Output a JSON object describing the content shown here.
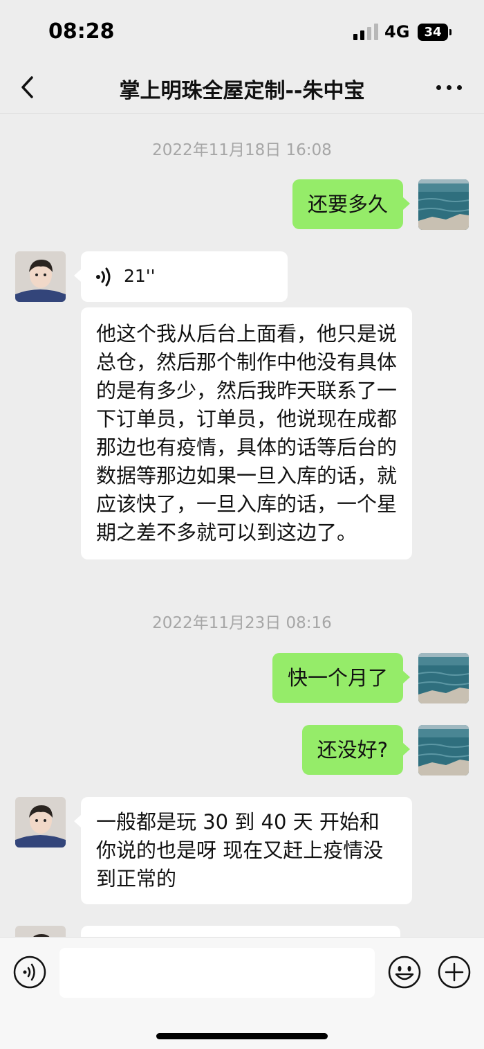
{
  "status_bar": {
    "time": "08:28",
    "network": "4G",
    "battery": "34",
    "signal_level": 2,
    "signal_max": 4
  },
  "nav": {
    "title": "掌上明珠全屋定制--朱中宝",
    "back_icon": "chevron-left-icon",
    "more_icon": "ellipsis-icon"
  },
  "chat": {
    "messages": [
      {
        "type": "timestamp",
        "text": "2022年11月18日 16:08"
      },
      {
        "type": "text",
        "sender": "me",
        "text": "还要多久"
      },
      {
        "type": "voice",
        "sender": "other",
        "duration": "21''"
      },
      {
        "type": "text",
        "sender": "other",
        "text": "他这个我从后台上面看，他只是说总仓，然后那个制作中他没有具体的是有多少，然后我昨天联系了一下订单员，订单员，他说现在成都那边也有疫情，具体的话等后台的数据等那边如果一旦入库的话，就应该快了，一旦入库的话，一个星期之差不多就可以到这边了。"
      },
      {
        "type": "timestamp",
        "text": "2022年11月23日 08:16"
      },
      {
        "type": "text",
        "sender": "me",
        "text": "快一个月了"
      },
      {
        "type": "text",
        "sender": "me",
        "text": "还没好?"
      },
      {
        "type": "text",
        "sender": "other",
        "text": "一般都是玩 30 到 40 天  开始和你说的也是呀  现在又赶上疫情没到正常的"
      }
    ]
  },
  "input_bar": {
    "voice_icon": "voice-mode-icon",
    "emoji_icon": "emoji-icon",
    "plus_icon": "plus-icon",
    "text_value": ""
  },
  "colors": {
    "background": "#ededed",
    "my_bubble": "#95ec69",
    "their_bubble": "#ffffff",
    "timestamp": "#a6a6a6"
  }
}
